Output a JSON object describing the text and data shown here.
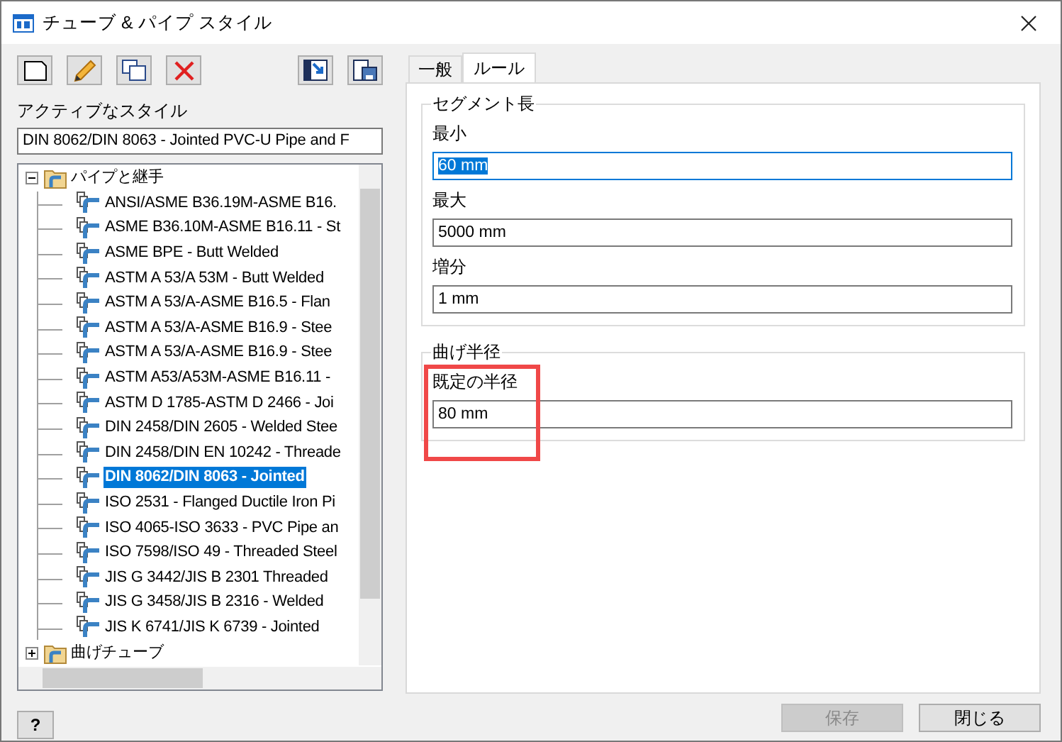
{
  "window": {
    "title": "チューブ & パイプ スタイル"
  },
  "active_style": {
    "label": "アクティブなスタイル",
    "value": "DIN 8062/DIN 8063 - Jointed PVC-U Pipe and F"
  },
  "tree": [
    {
      "label": "パイプと継手",
      "expanded": true,
      "selected": false,
      "children": [
        {
          "label": "ANSI/ASME B36.19M-ASME B16.",
          "selected": false
        },
        {
          "label": "ASME B36.10M-ASME B16.11 - St",
          "selected": false
        },
        {
          "label": "ASME BPE - Butt Welded",
          "selected": false
        },
        {
          "label": "ASTM A 53/A 53M - Butt Welded",
          "selected": false
        },
        {
          "label": "ASTM A 53/A-ASME B16.5 - Flan",
          "selected": false
        },
        {
          "label": "ASTM A 53/A-ASME B16.9 - Stee",
          "selected": false
        },
        {
          "label": "ASTM A 53/A-ASME B16.9 - Stee",
          "selected": false
        },
        {
          "label": "ASTM A53/A53M-ASME B16.11 -",
          "selected": false
        },
        {
          "label": "ASTM D 1785-ASTM D 2466 - Joi",
          "selected": false
        },
        {
          "label": "DIN 2458/DIN 2605 - Welded Stee",
          "selected": false
        },
        {
          "label": "DIN 2458/DIN EN 10242 - Threade",
          "selected": false
        },
        {
          "label": "DIN 8062/DIN 8063 - Jointed",
          "selected": true
        },
        {
          "label": "ISO 2531 - Flanged Ductile Iron Pi",
          "selected": false
        },
        {
          "label": "ISO 4065-ISO 3633 - PVC Pipe an",
          "selected": false
        },
        {
          "label": "ISO 7598/ISO 49 - Threaded Steel",
          "selected": false
        },
        {
          "label": "JIS G 3442/JIS B 2301 Threaded",
          "selected": false
        },
        {
          "label": "JIS G 3458/JIS B 2316 -  Welded",
          "selected": false
        },
        {
          "label": "JIS K 6741/JIS K 6739 - Jointed",
          "selected": false
        }
      ]
    },
    {
      "label": "曲げチューブ",
      "expanded": false,
      "selected": false
    }
  ],
  "help": "?",
  "tabs": [
    {
      "label": "一般",
      "selected": false
    },
    {
      "label": "ルール",
      "selected": true
    }
  ],
  "groups": [
    {
      "title": "セグメント長",
      "fields": [
        {
          "label": "最小",
          "value": "60 mm",
          "focused": true
        },
        {
          "label": "最大",
          "value": "5000 mm",
          "focused": false
        },
        {
          "label": "増分",
          "value": "1 mm",
          "focused": false
        }
      ]
    },
    {
      "title": "曲げ半径",
      "fields": [
        {
          "label": "既定の半径",
          "value": "80 mm",
          "focused": false
        }
      ]
    }
  ],
  "buttons": [
    {
      "label": "保存",
      "disabled": true
    },
    {
      "label": "閉じる",
      "disabled": false
    }
  ]
}
